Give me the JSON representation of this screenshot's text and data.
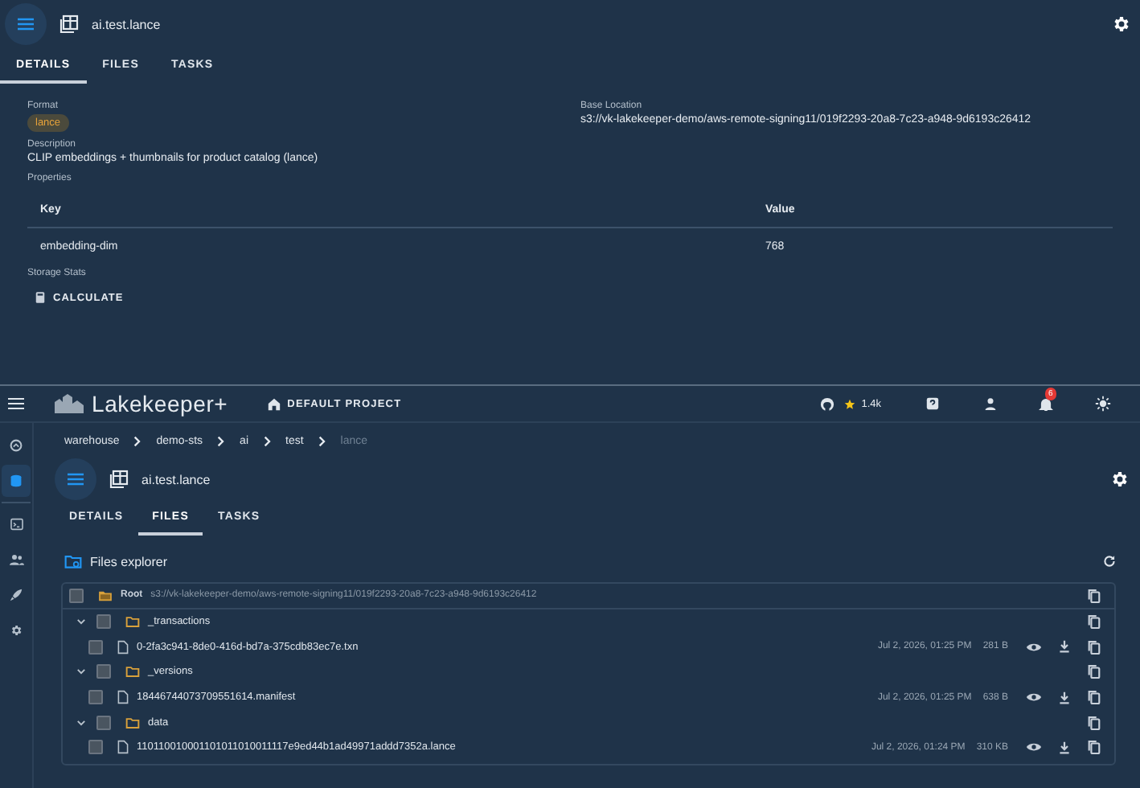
{
  "top_panel": {
    "title": "ai.test.lance",
    "tabs": [
      {
        "label": "DETAILS",
        "selected": true
      },
      {
        "label": "FILES",
        "selected": false
      },
      {
        "label": "TASKS",
        "selected": false
      }
    ],
    "format_label": "Format",
    "format": "lance",
    "base_location_label": "Base Location",
    "base_location": "s3://vk-lakekeeper-demo/aws-remote-signing11/019f2293-20a8-7c23-a948-9d6193c26412",
    "description_label": "Description",
    "description": "CLIP embeddings + thumbnails for product catalog (lance)",
    "properties_label": "Properties",
    "properties": {
      "columns": [
        "Key",
        "Value"
      ],
      "rows": [
        [
          "embedding-dim",
          "768"
        ]
      ]
    },
    "storage_label": "Storage Stats",
    "calculate_button": "CALCULATE"
  },
  "app_bar": {
    "logo": "Lakekeeper+",
    "project": "DEFAULT PROJECT",
    "stars": "1.4k",
    "notifications": "6"
  },
  "sidebar": {
    "items": [
      {
        "kind": "home",
        "selected": false
      },
      {
        "kind": "database",
        "selected": true
      },
      {
        "kind": "terminal",
        "selected": false
      },
      {
        "kind": "people",
        "selected": false
      },
      {
        "kind": "rocket",
        "selected": false
      },
      {
        "kind": "settings",
        "selected": false
      }
    ]
  },
  "breadcrumbs": [
    {
      "label": "warehouse",
      "current": false
    },
    {
      "label": "demo-sts",
      "current": false
    },
    {
      "label": "ai",
      "current": false
    },
    {
      "label": "test",
      "current": false
    },
    {
      "label": "lance",
      "current": true
    }
  ],
  "table_view": {
    "title": "ai.test.lance",
    "tabs": [
      {
        "label": "DETAILS",
        "selected": false
      },
      {
        "label": "FILES",
        "selected": true
      },
      {
        "label": "TASKS",
        "selected": false
      }
    ]
  },
  "files_explorer": {
    "title": "Files explorer",
    "root_label": "Root",
    "root_path": "s3://vk-lakekeeper-demo/aws-remote-signing11/019f2293-20a8-7c23-a948-9d6193c26412",
    "root_checked": false,
    "tree": [
      {
        "kind": "folder",
        "name": "_transactions",
        "expanded": true,
        "checked": false,
        "children": [
          {
            "kind": "file",
            "name": "0-2fa3c941-8de0-416d-bd7a-375cdb83ec7e.txn",
            "modified": "Jul 2, 2026, 01:25 PM",
            "size": "281 B",
            "checked": false
          }
        ]
      },
      {
        "kind": "folder",
        "name": "_versions",
        "expanded": true,
        "checked": false,
        "children": [
          {
            "kind": "file",
            "name": "18446744073709551614.manifest",
            "modified": "Jul 2, 2026, 01:25 PM",
            "size": "638 B",
            "checked": false
          }
        ]
      },
      {
        "kind": "folder",
        "name": "data",
        "expanded": true,
        "checked": false,
        "children": [
          {
            "kind": "file",
            "name": "110110010001101011010011117e9ed44b1ad49971addd7352a.lance",
            "modified": "Jul 2, 2026, 01:24 PM",
            "size": "310 KB",
            "checked": false
          }
        ]
      }
    ]
  }
}
